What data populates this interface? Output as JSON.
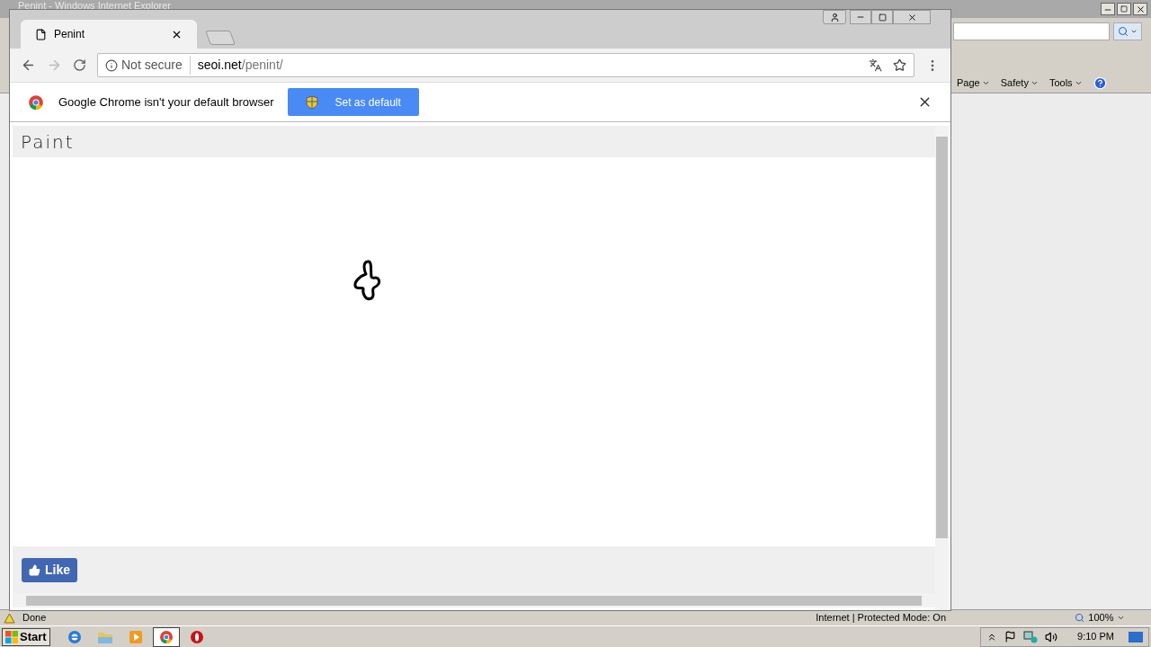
{
  "ie_window": {
    "title": "Penint - Windows Internet Explorer",
    "toolbar": [
      "Page",
      "Safety",
      "Tools"
    ],
    "status": "Done",
    "zone": "Internet | Protected Mode: On",
    "zoom": "100%"
  },
  "chrome": {
    "tab": {
      "title": "Penint",
      "selected": true
    },
    "address": {
      "security": "Not secure",
      "host": "seoi.net",
      "path": "/penint/"
    },
    "infobar": {
      "message": "Google Chrome isn't your default browser",
      "button": "Set as default"
    }
  },
  "page": {
    "heading": "Paint",
    "like": "Like"
  },
  "taskbar": {
    "start": "Start",
    "clock": "9:10 PM",
    "apps": [
      {
        "kind": "ie",
        "selected": false
      },
      {
        "kind": "folder",
        "selected": false
      },
      {
        "kind": "media",
        "selected": false
      },
      {
        "kind": "chrome",
        "selected": true
      },
      {
        "kind": "opera",
        "selected": false
      }
    ]
  }
}
